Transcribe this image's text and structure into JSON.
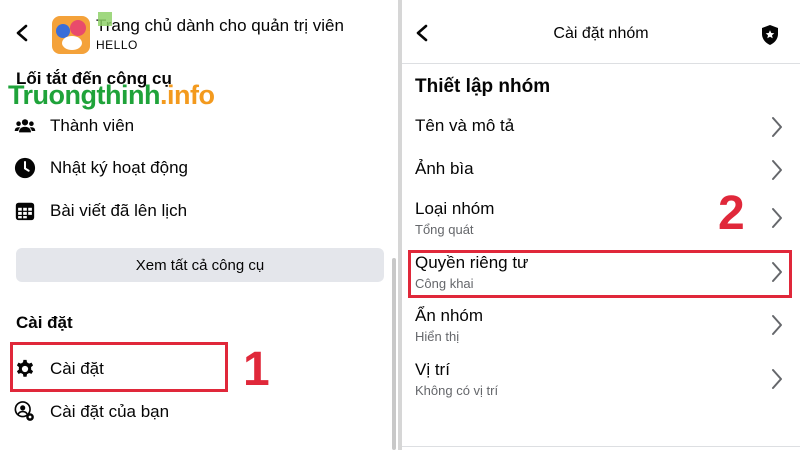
{
  "left": {
    "group_title": "Trang chủ dành cho quản trị viên",
    "group_subtitle": "HELLO",
    "watermark": {
      "main": "Truongthinh",
      "tld": ".info"
    },
    "shortcuts_heading": "Lối tắt đến công cụ",
    "shortcuts": [
      {
        "label": "Thành viên",
        "icon": "members-icon"
      },
      {
        "label": "Nhật ký hoạt động",
        "icon": "clock-icon"
      },
      {
        "label": "Bài viết đã lên lịch",
        "icon": "calendar-icon"
      }
    ],
    "see_all_label": "Xem tất cả công cụ",
    "settings_heading": "Cài đặt",
    "settings_items": [
      {
        "label": "Cài đặt",
        "icon": "gear-icon"
      },
      {
        "label": "Cài đặt của bạn",
        "icon": "user-gear-icon"
      }
    ],
    "step_number": "1"
  },
  "right": {
    "title": "Cài đặt nhóm",
    "heading": "Thiết lập nhóm",
    "rows": [
      {
        "title": "Tên và mô tả",
        "subtitle": ""
      },
      {
        "title": "Ảnh bìa",
        "subtitle": ""
      },
      {
        "title": "Loại nhóm",
        "subtitle": "Tổng quát"
      },
      {
        "title": "Quyền riêng tư",
        "subtitle": "Công khai"
      },
      {
        "title": "Ẩn nhóm",
        "subtitle": "Hiển thị"
      },
      {
        "title": "Vị trí",
        "subtitle": "Không có vị trí"
      }
    ],
    "step_number": "2"
  },
  "colors": {
    "highlight": "#e0283a",
    "watermark_green": "#1fa33a",
    "watermark_orange": "#f39a1e",
    "button_bg": "#e4e6eb",
    "subtitle_text": "#65676b"
  }
}
